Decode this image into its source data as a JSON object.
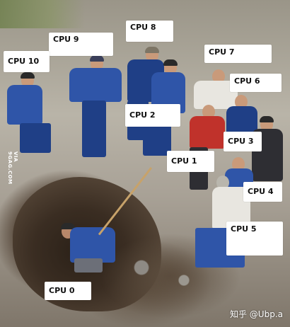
{
  "labels": {
    "cpu0": "CPU 0",
    "cpu1": "CPU 1",
    "cpu2": "CPU 2",
    "cpu3": "CPU 3",
    "cpu4": "CPU 4",
    "cpu5": "CPU 5",
    "cpu6": "CPU 6",
    "cpu7": "CPU 7",
    "cpu8": "CPU 8",
    "cpu9": "CPU 9",
    "cpu10": "CPU 10"
  },
  "watermarks": {
    "side": "VIA 9GAG.COM",
    "corner": "知乎 @Ubp.a"
  }
}
